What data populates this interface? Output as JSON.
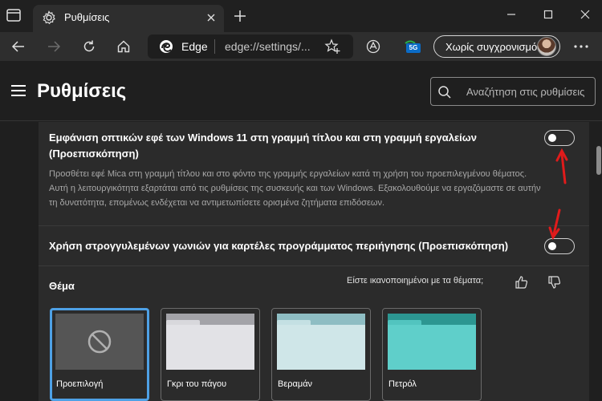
{
  "tab": {
    "title": "Ρυθμίσεις"
  },
  "addressbar": {
    "app_label": "Edge",
    "url": "edge://settings/..."
  },
  "extension_badge": "5G",
  "sync": {
    "label": "Χωρίς συγχρονισμό"
  },
  "page": {
    "title": "Ρυθμίσεις"
  },
  "search": {
    "placeholder": "Αναζήτηση στις ρυθμίσεις"
  },
  "settings": {
    "mica": {
      "title": "Εμφάνιση οπτικών εφέ των Windows 11 στη γραμμή τίτλου και στη γραμμή εργαλείων (Προεπισκόπηση)",
      "description": "Προσθέτει εφέ Mica στη γραμμή τίτλου και στο φόντο της γραμμής εργαλείων κατά τη χρήση του προεπιλεγμένου θέματος. Αυτή η λειτουργικότητα εξαρτάται από τις ρυθμίσεις της συσκευής και των Windows. Εξακολουθούμε να εργαζόμαστε σε αυτήν τη δυνατότητα, επομένως ενδέχεται να αντιμετωπίσετε ορισμένα ζητήματα επιδόσεων.",
      "enabled": false
    },
    "rounded_tabs": {
      "title": "Χρήση στρογγυλεμένων γωνιών για καρτέλες προγράμματος περιήγησης (Προεπισκόπηση)",
      "enabled": false
    }
  },
  "theme": {
    "label": "Θέμα",
    "feedback_question": "Είστε ικανοποιημένοι με τα θέματα;",
    "options": [
      {
        "name": "Προεπιλογή",
        "selected": true
      },
      {
        "name": "Γκρι του πάγου",
        "selected": false,
        "color": "#e2e2e6",
        "tab_color": "#b9b9bf"
      },
      {
        "name": "Βεραμάν",
        "selected": false,
        "color": "#cfe6e8",
        "tab_color": "#9fc9cf"
      },
      {
        "name": "Πετρόλ",
        "selected": false,
        "color": "#5fcfca",
        "tab_color": "#35a5a1"
      }
    ]
  },
  "colors": {
    "accent": "#4ea1e6",
    "annotation": "#e01b1b"
  }
}
